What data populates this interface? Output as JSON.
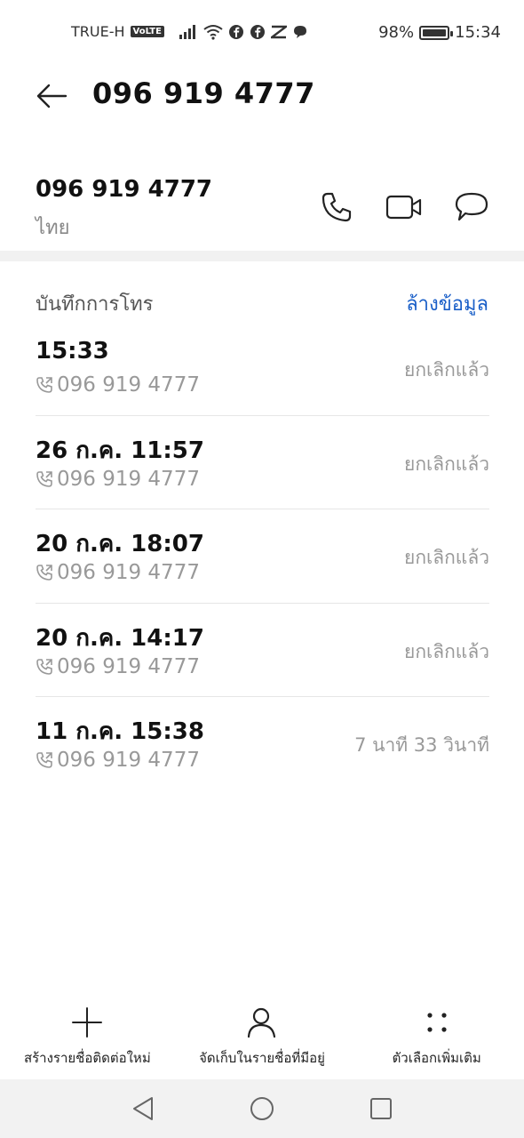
{
  "status_bar": {
    "carrier": "TRUE-H",
    "volte": "VoLTE",
    "battery": "98%",
    "time": "15:34"
  },
  "header": {
    "title": "096 919 4777"
  },
  "contact": {
    "number": "096 919 4777",
    "region": "ไทย"
  },
  "call_log": {
    "title": "บันทึกการโทร",
    "clear_label": "ล้างข้อมูล",
    "items": [
      {
        "time": "15:33",
        "number": "096 919 4777",
        "status": "ยกเลิกแล้ว"
      },
      {
        "time": "26 ก.ค. 11:57",
        "number": "096 919 4777",
        "status": "ยกเลิกแล้ว"
      },
      {
        "time": "20 ก.ค. 18:07",
        "number": "096 919 4777",
        "status": "ยกเลิกแล้ว"
      },
      {
        "time": "20 ก.ค. 14:17",
        "number": "096 919 4777",
        "status": "ยกเลิกแล้ว"
      },
      {
        "time": "11 ก.ค. 15:38",
        "number": "096 919 4777",
        "status": "7 นาที 33 วินาที"
      }
    ]
  },
  "toolbar": {
    "new_contact": "สร้างรายชื่อติดต่อใหม่",
    "save_existing": "จัดเก็บในรายชื่อที่มีอยู่",
    "more_options": "ตัวเลือกเพิ่มเติม"
  },
  "colors": {
    "accent": "#1a5fc8",
    "secondary_text": "#999999"
  }
}
